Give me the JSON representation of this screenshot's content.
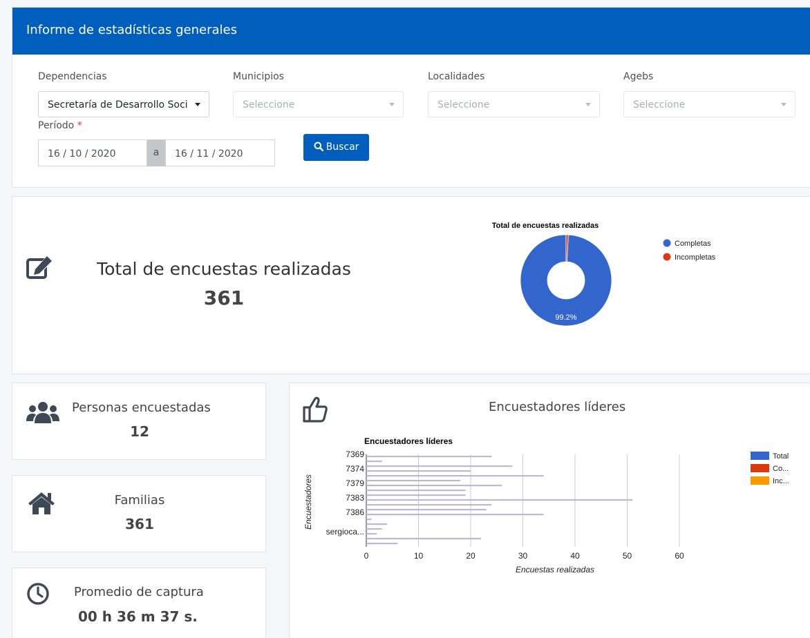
{
  "header": {
    "title": "Informe de estadísticas generales"
  },
  "filters": {
    "dependencias": {
      "label": "Dependencias",
      "value": "Secretaría de Desarrollo Soci"
    },
    "municipios": {
      "label": "Municipios",
      "placeholder": "Seleccione"
    },
    "localidades": {
      "label": "Localidades",
      "placeholder": "Seleccione"
    },
    "agebs": {
      "label": "Agebs",
      "placeholder": "Seleccione"
    },
    "periodo": {
      "label": "Período",
      "required_mark": "*",
      "from": "16 / 10 / 2020",
      "separator": "a",
      "to": "16 / 11 / 2020"
    },
    "search_label": "Buscar"
  },
  "summary": {
    "title": "Total de encuestas realizadas",
    "value": "361"
  },
  "cards": {
    "personas": {
      "title": "Personas encuestadas",
      "value": "12"
    },
    "familias": {
      "title": "Familias",
      "value": "361"
    },
    "promedio": {
      "title": "Promedio de captura",
      "value": "00 h 36 m 37 s."
    }
  },
  "leaders": {
    "title": "Encuestadores líderes"
  },
  "colors": {
    "primary": "#005ebd",
    "completas": "#3366cc",
    "incompletas": "#dc3912",
    "third": "#ff9900"
  },
  "icons": [
    "edit-icon",
    "users-icon",
    "home-icon",
    "clock-icon",
    "thumbs-up-icon",
    "search-icon",
    "caret-down-icon"
  ],
  "chart_data": [
    {
      "type": "pie",
      "title": "Total de encuestas realizadas",
      "legend_position": "right",
      "series": [
        {
          "name": "Completas",
          "value": 99.2,
          "label": "99.2%"
        },
        {
          "name": "Incompletas",
          "value": 0.8
        }
      ]
    },
    {
      "type": "bar",
      "orientation": "horizontal",
      "title": "Encuestadores líderes",
      "xlabel": "Encuestas realizadas",
      "ylabel": "Encuestadores",
      "xlim": [
        0,
        60
      ],
      "xticks": [
        0,
        10,
        20,
        30,
        40,
        50,
        60
      ],
      "grid": true,
      "legend_position": "right",
      "legend": [
        "Total",
        "Co...",
        "Inc..."
      ],
      "tick_labels": [
        "7369",
        "7374",
        "7379",
        "7383",
        "7386",
        "sergioca..."
      ],
      "values": [
        24,
        3,
        28,
        20,
        34,
        18,
        26,
        19,
        19,
        51,
        24,
        23,
        34,
        1,
        4,
        3,
        2,
        22,
        6
      ]
    }
  ]
}
